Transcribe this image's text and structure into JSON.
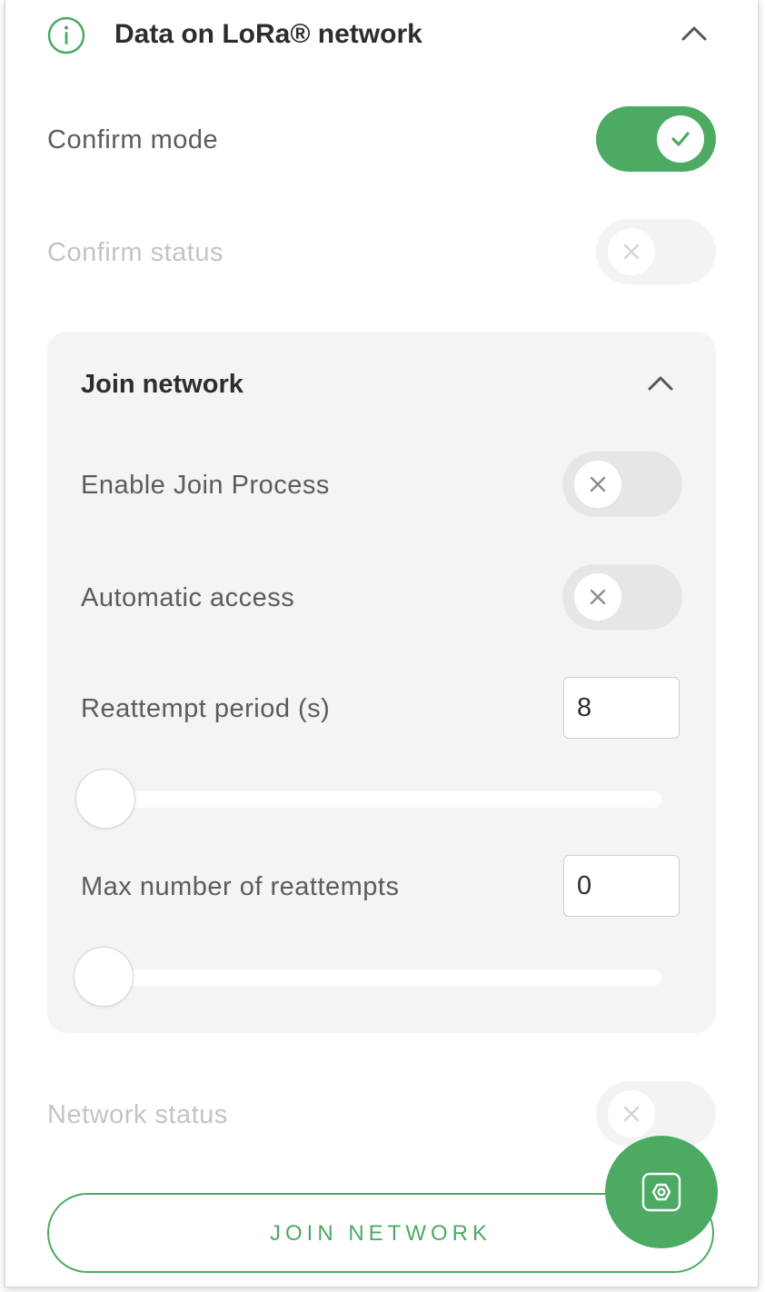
{
  "header": {
    "title": "Data on LoRa® network",
    "info_icon": "info-circle-icon",
    "collapse_icon": "chevron-up-icon"
  },
  "confirm_mode": {
    "label": "Confirm mode",
    "state": "on"
  },
  "confirm_status": {
    "label": "Confirm status",
    "state": "off",
    "disabled": true
  },
  "join_network_section": {
    "title": "Join network",
    "collapse_icon": "chevron-up-icon",
    "enable_join": {
      "label": "Enable Join Process",
      "state": "off"
    },
    "automatic_access": {
      "label": "Automatic access",
      "state": "off"
    },
    "reattempt_period": {
      "label": "Reattempt period (s)",
      "value": "8",
      "slider_level": 0
    },
    "max_reattempts": {
      "label": "Max number of reattempts",
      "value": "0",
      "slider_level": 0
    }
  },
  "network_status": {
    "label": "Network status",
    "state": "off",
    "disabled": true
  },
  "join_button": {
    "label": "JOIN NETWORK"
  },
  "fab": {
    "icon": "hexagon-settings-icon"
  },
  "colors": {
    "accent": "#4caa62",
    "text_dark": "#2d2d2d",
    "text_label": "#5c5c5c",
    "text_muted": "#c4c4c4",
    "card_bg": "#f3f4f5"
  }
}
